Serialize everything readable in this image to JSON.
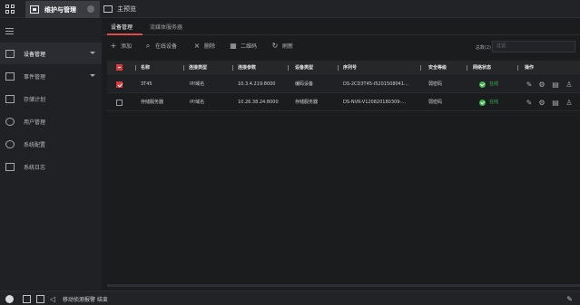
{
  "titlebar": {
    "active_tab_label": "维护与管理",
    "preview_tab_label": "主预览"
  },
  "sidebar": {
    "items": [
      {
        "label": "设备管理",
        "icon": "device-management-icon",
        "active": true,
        "has_caret": true
      },
      {
        "label": "事件管理",
        "icon": "event-management-icon",
        "active": false,
        "has_caret": true
      },
      {
        "label": "存储计划",
        "icon": "storage-schedule-icon",
        "active": false,
        "has_caret": false
      },
      {
        "label": "用户管理",
        "icon": "user-management-icon",
        "active": false,
        "has_caret": false
      },
      {
        "label": "系统配置",
        "icon": "system-config-icon",
        "active": false,
        "has_caret": false
      },
      {
        "label": "系统日志",
        "icon": "system-log-icon",
        "active": false,
        "has_caret": false
      }
    ]
  },
  "subtabs": {
    "device_management": "设备管理",
    "streaming_server": "流媒体服务器"
  },
  "toolbar": {
    "add_label": "添加",
    "online_devices_label": "在线设备",
    "delete_label": "删除",
    "qrcode_label": "二维码",
    "refresh_label": "刷新",
    "total_label": "总数(2)",
    "filter_placeholder": "过滤"
  },
  "table": {
    "headers": {
      "name": "名称",
      "connection_type": "连接类型",
      "connection_params": "连接参数",
      "device_type": "设备类型",
      "serial_number": "序列号",
      "security_level": "安全等级",
      "network_status": "网络状态",
      "operation": "操作"
    },
    "rows": [
      {
        "checked": true,
        "name": "3T45",
        "connection_type": "IP/域名",
        "connection_params": "10.3.4.219:8000",
        "device_type": "编码设备",
        "serial_number": "DS-2CD3T45-I5201508041...",
        "security_level": "弱密码",
        "network_status": "在线"
      },
      {
        "checked": false,
        "name": "存储服务器",
        "connection_type": "IP/域名",
        "connection_params": "10.26.38.24:8000",
        "device_type": "存储服务器",
        "serial_number": "DS-NVR-V12082018030​9-...",
        "security_level": "弱密码",
        "network_status": "在线"
      }
    ]
  },
  "statusbar": {
    "message": "移动侦测报警 结束"
  },
  "colors": {
    "accent_red": "#d43b3b",
    "online_green": "#3ab54a",
    "background": "#1b1c1e"
  }
}
